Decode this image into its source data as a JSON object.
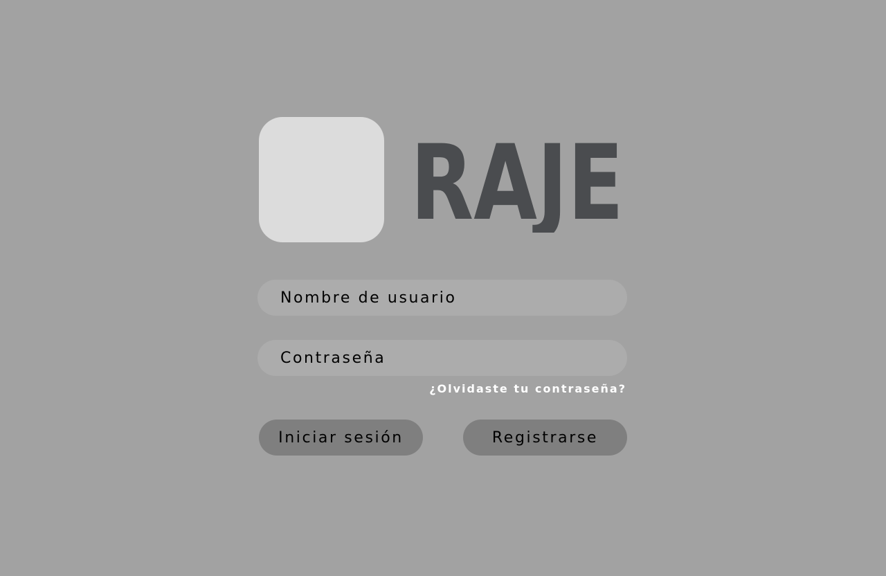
{
  "brand": {
    "wordmark": "RAJE",
    "wordmark_color": "#4a4c4f",
    "logo_color": "#dcdcdc"
  },
  "form": {
    "username_placeholder": "Nombre de usuario",
    "password_placeholder": "Contraseña",
    "forgot_link": "¿Olvidaste tu contraseña?",
    "login_label": "Iniciar sesión",
    "register_label": "Registrarse"
  },
  "colors": {
    "background": "#a2a2a2",
    "input_fill": "#acacac",
    "button_fill": "#7f7f7f"
  }
}
